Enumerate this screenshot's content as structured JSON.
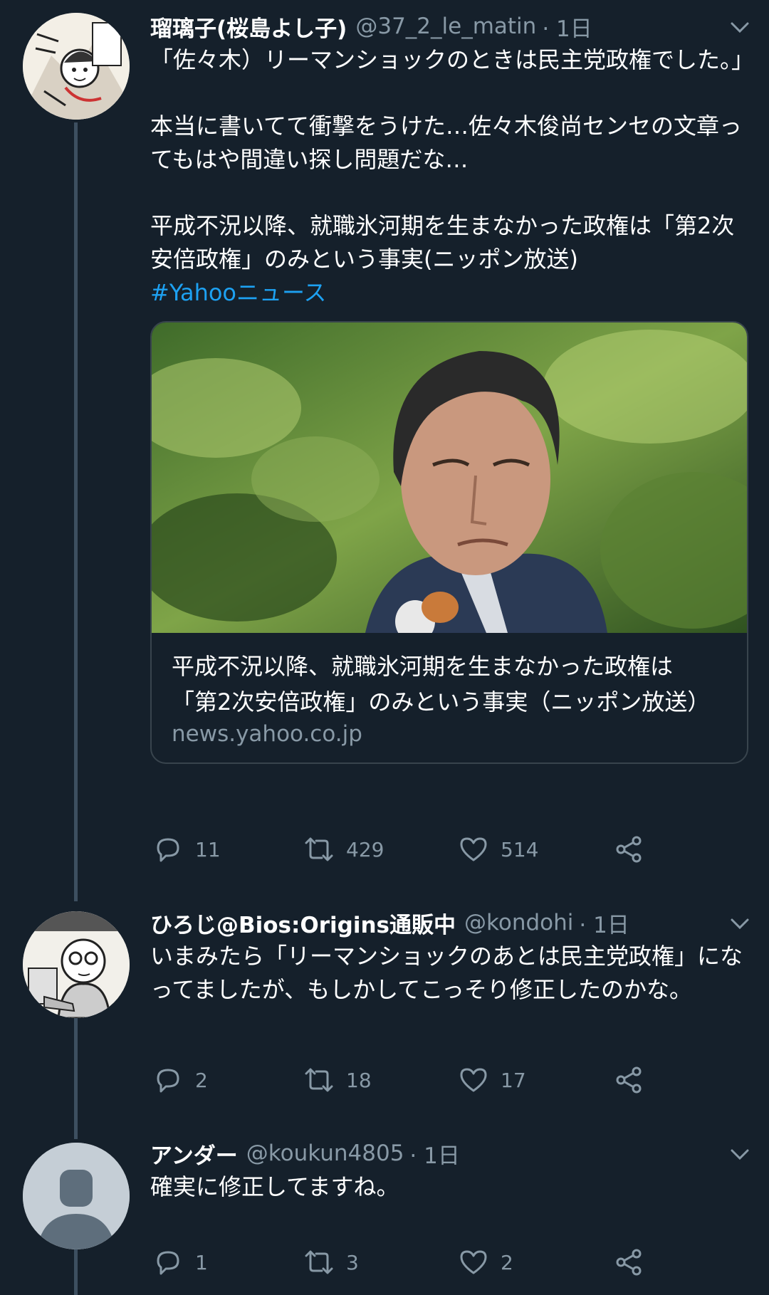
{
  "tweets": [
    {
      "name": "瑠璃子(桜島よし子)",
      "handle": "@37_2_le_matin",
      "time": "· 1日",
      "paragraphs": [
        "「佐々木）リーマンショックのときは民主党政権でした。」",
        "本当に書いてて衝撃をうけた…佐々木俊尚センセの文章ってもはや間違い探し問題だな…",
        "平成不況以降、就職氷河期を生まなかった政権は「第2次安倍政権」のみという事実(ニッポン放送)"
      ],
      "hashtag": "#Yahooニュース",
      "card": {
        "title_line1": "平成不況以降、就職氷河期を生まなかった政権は",
        "title_line2": "「第2次安倍政権」のみという事実（ニッポン放送）",
        "domain": "news.yahoo.co.jp"
      },
      "replies": "11",
      "retweets": "429",
      "likes": "514"
    },
    {
      "name": "ひろじ@Bios:Origins通販中",
      "handle": "@kondohi",
      "time": "· 1日",
      "text": "いまみたら「リーマンショックのあとは民主党政権」になってましたが、もしかしてこっそり修正したのかな。",
      "replies": "2",
      "retweets": "18",
      "likes": "17"
    },
    {
      "name": "アンダー",
      "handle": "@koukun4805",
      "time": "· 1日",
      "text": "確実に修正してますね。",
      "replies": "1",
      "retweets": "3",
      "likes": "2"
    }
  ],
  "colors": {
    "background": "#15202b",
    "thread_line": "#3d4f60",
    "secondary_text": "#8899a6",
    "link": "#1da1f2"
  },
  "icons": [
    "reply-icon",
    "retweet-icon",
    "like-icon",
    "share-icon",
    "caret-down-icon"
  ]
}
